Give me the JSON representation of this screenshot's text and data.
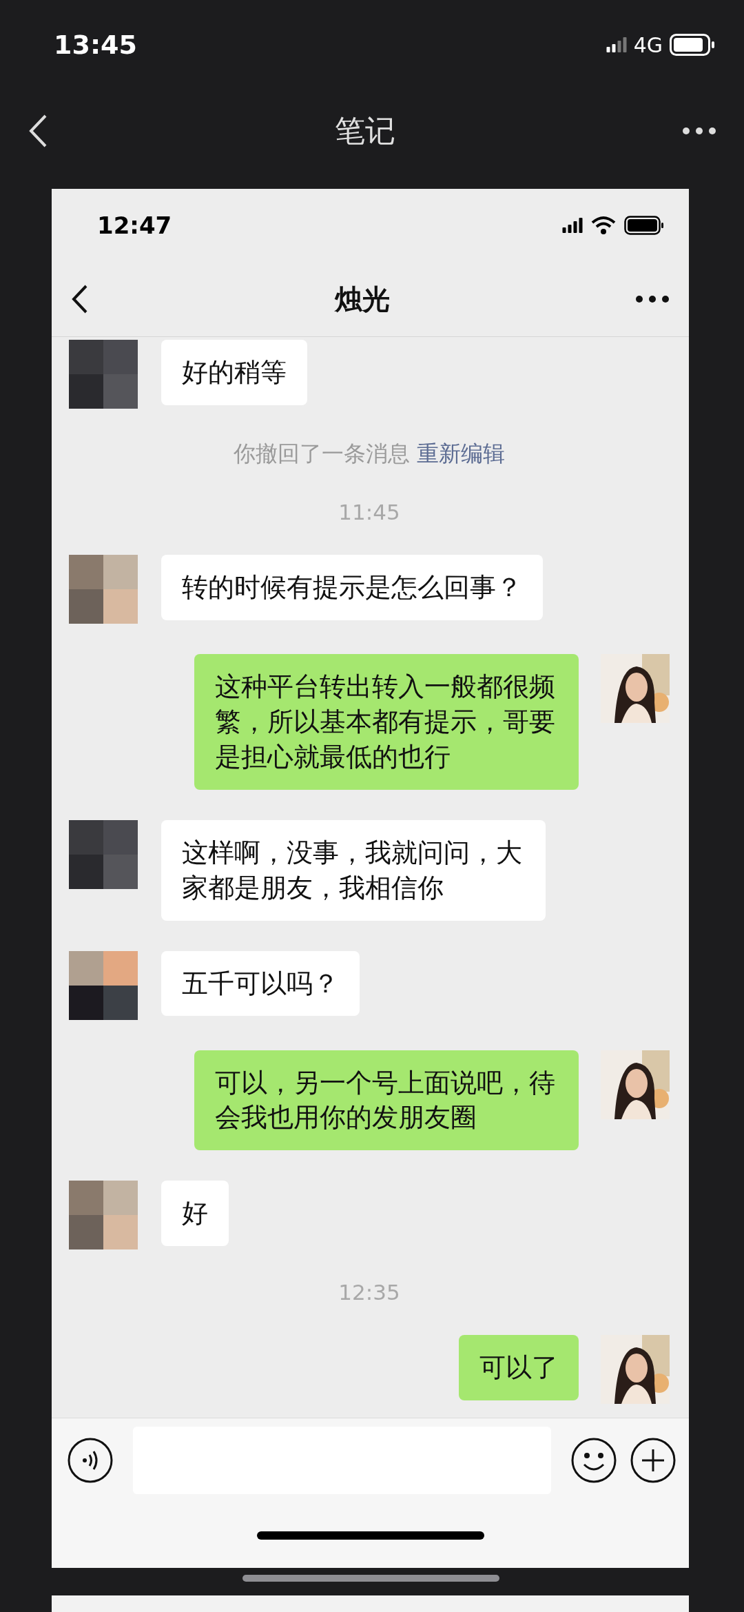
{
  "outer_status": {
    "time": "13:45",
    "network": "4G"
  },
  "header": {
    "title": "笔记"
  },
  "screenshot": {
    "status": {
      "time": "12:47"
    },
    "chat_title": "烛光",
    "messages": [
      {
        "kind": "incoming",
        "text": "好的稍等"
      },
      {
        "kind": "system",
        "text": "你撤回了一条消息",
        "link": "重新编辑"
      },
      {
        "kind": "time",
        "text": "11:45"
      },
      {
        "kind": "incoming",
        "text": "转的时候有提示是怎么回事？"
      },
      {
        "kind": "outgoing",
        "text": "这种平台转出转入一般都很频繁，所以基本都有提示，哥要是担心就最低的也行"
      },
      {
        "kind": "incoming",
        "text": "这样啊，没事，我就问问，大家都是朋友，我相信你"
      },
      {
        "kind": "incoming",
        "text": "五千可以吗？"
      },
      {
        "kind": "outgoing",
        "text": "可以，另一个号上面说吧，待会我也用你的发朋友圈"
      },
      {
        "kind": "incoming",
        "text": "好"
      },
      {
        "kind": "time",
        "text": "12:35"
      },
      {
        "kind": "outgoing",
        "text": "可以了"
      }
    ]
  }
}
